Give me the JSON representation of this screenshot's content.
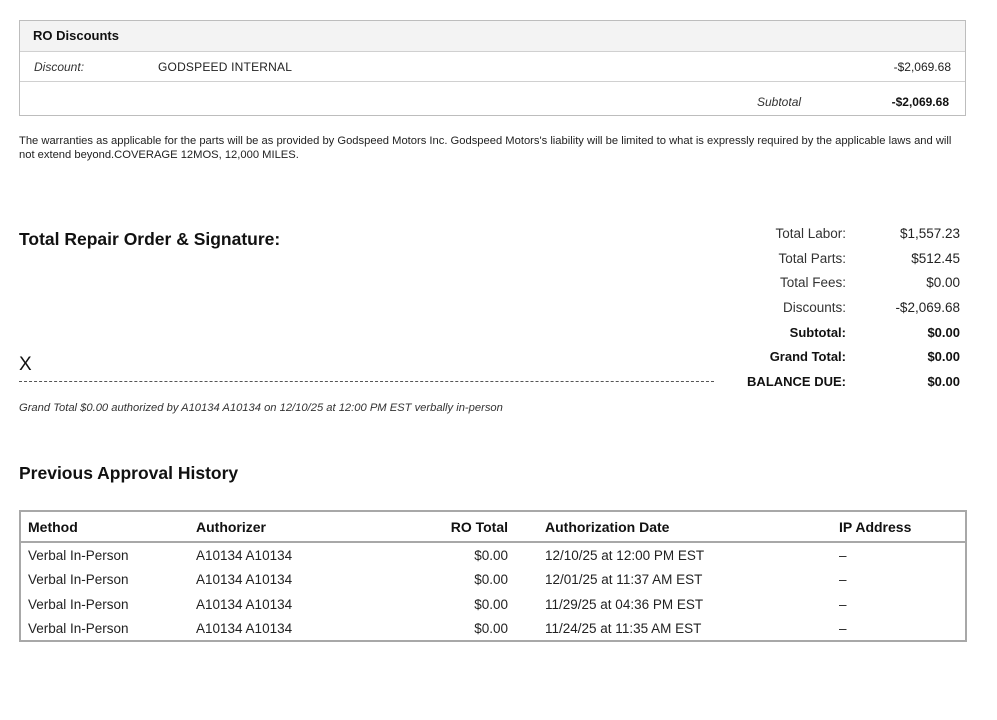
{
  "ro_discounts": {
    "title": "RO Discounts",
    "rows": [
      {
        "label": "Discount:",
        "name": "GODSPEED INTERNAL",
        "amount": "-$2,069.68"
      }
    ],
    "subtotal_label": "Subtotal",
    "subtotal_amount": "-$2,069.68"
  },
  "warranty_text": "The warranties as applicable for the parts will be as provided by Godspeed Motors Inc. Godspeed Motors's liability will be limited to what is expressly required by the applicable laws and will not extend beyond.COVERAGE 12MOS, 12,000 MILES.",
  "signature": {
    "title": "Total Repair Order & Signature:",
    "x_mark": "X",
    "note": "Grand Total $0.00 authorized  by A10134 A10134 on 12/10/25 at 12:00 PM EST verbally in-person"
  },
  "totals": [
    {
      "label": "Total Labor:",
      "value": "$1,557.23",
      "bold": false
    },
    {
      "label": "Total Parts:",
      "value": "$512.45",
      "bold": false
    },
    {
      "label": "Total Fees:",
      "value": "$0.00",
      "bold": false
    },
    {
      "label": "Discounts:",
      "value": "-$2,069.68",
      "bold": false
    },
    {
      "label": "Subtotal:",
      "value": "$0.00",
      "bold": true
    },
    {
      "label": "Grand Total:",
      "value": "$0.00",
      "bold": true
    },
    {
      "label": "BALANCE DUE:",
      "value": "$0.00",
      "bold": true
    }
  ],
  "history": {
    "title": "Previous Approval History",
    "columns": [
      "Method",
      "Authorizer",
      "RO Total",
      "Authorization Date",
      "IP Address"
    ],
    "rows": [
      [
        "Verbal In-Person",
        "A10134 A10134",
        "$0.00",
        "12/10/25 at 12:00 PM EST",
        "–"
      ],
      [
        "Verbal In-Person",
        "A10134 A10134",
        "$0.00",
        "12/01/25 at 11:37 AM EST",
        "–"
      ],
      [
        "Verbal In-Person",
        "A10134 A10134",
        "$0.00",
        "11/29/25 at 04:36 PM EST",
        "–"
      ],
      [
        "Verbal In-Person",
        "A10134 A10134",
        "$0.00",
        "11/24/25 at 11:35 AM EST",
        "–"
      ]
    ]
  }
}
